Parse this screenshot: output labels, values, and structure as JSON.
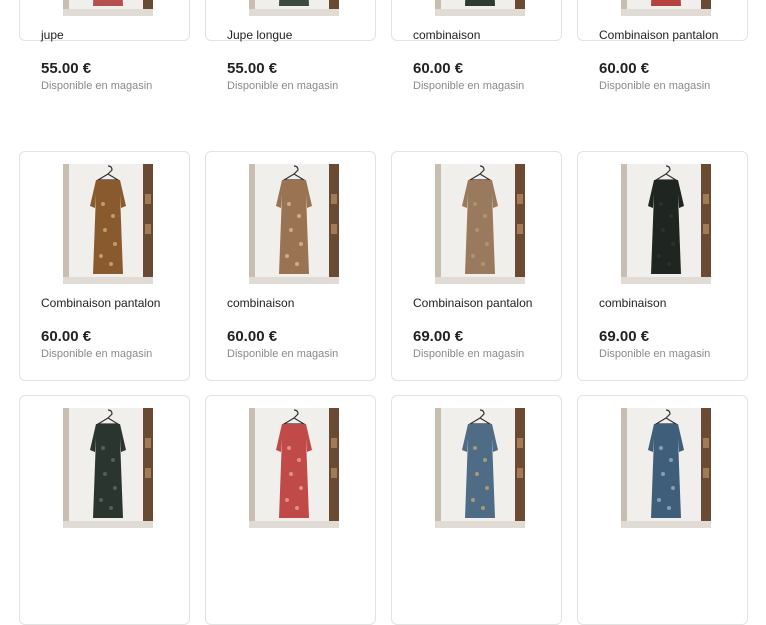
{
  "products": [
    {
      "name": "jupe",
      "price": "55.00 €",
      "availability": "Disponible en magasin",
      "dress_color": "#b84f4f",
      "pattern_color": "#e2b8a6"
    },
    {
      "name": "Jupe longue",
      "price": "55.00 €",
      "availability": "Disponible en magasin",
      "dress_color": "#3d4a3e",
      "pattern_color": "#c8a05a"
    },
    {
      "name": "combinaison",
      "price": "60.00 €",
      "availability": "Disponible en magasin",
      "dress_color": "#2f3a35",
      "pattern_color": "#b7c7b4"
    },
    {
      "name": "Combinaison pantalon",
      "price": "60.00 €",
      "availability": "Disponible en magasin",
      "dress_color": "#b5433d",
      "pattern_color": "#e7c7be"
    },
    {
      "name": "Combinaison pantalon",
      "price": "60.00 €",
      "availability": "Disponible en magasin",
      "dress_color": "#8a5a2f",
      "pattern_color": "#d8b07d"
    },
    {
      "name": "combinaison",
      "price": "60.00 €",
      "availability": "Disponible en magasin",
      "dress_color": "#9a7352",
      "pattern_color": "#d9bfa0"
    },
    {
      "name": "Combinaison pantalon",
      "price": "69.00 €",
      "availability": "Disponible en magasin",
      "dress_color": "#9a7a5c",
      "pattern_color": "#b89b7b"
    },
    {
      "name": "combinaison",
      "price": "69.00 €",
      "availability": "Disponible en magasin",
      "dress_color": "#1f2622",
      "pattern_color": "#2d3630"
    },
    {
      "name": "",
      "price": "",
      "availability": "",
      "dress_color": "#2b3530",
      "pattern_color": "#5f6d64"
    },
    {
      "name": "",
      "price": "",
      "availability": "",
      "dress_color": "#c04a48",
      "pattern_color": "#e8a9a2"
    },
    {
      "name": "",
      "price": "",
      "availability": "",
      "dress_color": "#4f6c86",
      "pattern_color": "#c9a86a"
    },
    {
      "name": "",
      "price": "",
      "availability": "",
      "dress_color": "#3f5e7a",
      "pattern_color": "#9fb5c7"
    }
  ]
}
